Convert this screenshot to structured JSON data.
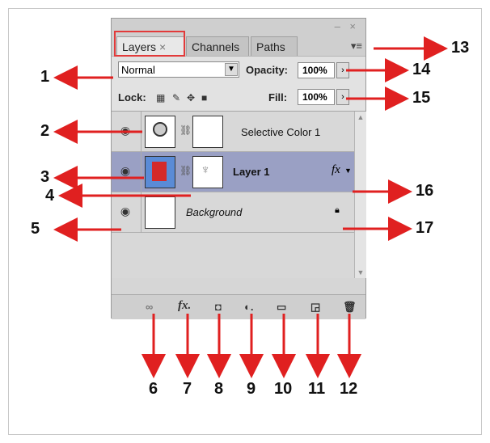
{
  "tabs": [
    {
      "label": "Layers",
      "close": "×"
    },
    {
      "label": "Channels"
    },
    {
      "label": "Paths"
    }
  ],
  "window_controls": "– ×",
  "panel_menu_icon": "≡",
  "blend_mode": "Normal",
  "opacity_label": "Opacity:",
  "opacity_value": "100%",
  "lock_label": "Lock:",
  "fill_label": "Fill:",
  "fill_value": "100%",
  "layers": [
    {
      "name": "Selective Color 1"
    },
    {
      "name": "Layer 1",
      "fx": "fx"
    },
    {
      "name": "Background"
    }
  ],
  "bottom_icons": [
    "link-layers",
    "add-layer-style",
    "add-mask",
    "new-adjustment-layer",
    "new-group",
    "new-layer",
    "delete-layer"
  ],
  "annotations": [
    "1",
    "2",
    "3",
    "4",
    "5",
    "6",
    "7",
    "8",
    "9",
    "10",
    "11",
    "12",
    "13",
    "14",
    "15",
    "16",
    "17"
  ],
  "colors": {
    "arrow": "#e02020",
    "selected_layer": "#9aa0c4",
    "highlight_box": "#e23a3a"
  }
}
